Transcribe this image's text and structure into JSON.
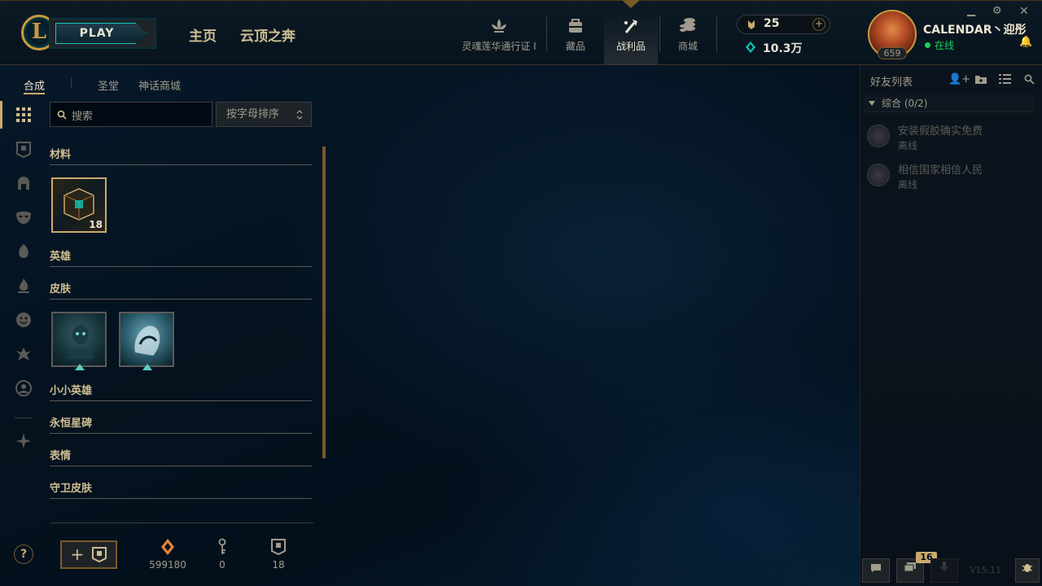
{
  "topbar": {
    "play_label": "PLAY",
    "logo_letter": "L",
    "nav_main": [
      {
        "label": "主页"
      },
      {
        "label": "云顶之奔"
      }
    ],
    "nav_icons": [
      {
        "label": "灵魂莲华通行证 I",
        "icon": "lotus-icon"
      },
      {
        "label": "藏品",
        "icon": "collection-bag-icon"
      },
      {
        "label": "战利品",
        "icon": "loot-crafting-icon",
        "active": true
      },
      {
        "label": "商城",
        "icon": "store-coins-icon"
      }
    ],
    "currency": {
      "rp": "25",
      "be": "10.3万"
    },
    "profile": {
      "name": "CALENDAR丶迎彤",
      "status": "在线",
      "level": "659"
    }
  },
  "loot": {
    "tabs": [
      {
        "label": "合成",
        "active": true
      },
      {
        "label": "圣堂"
      },
      {
        "label": "神话商城"
      }
    ],
    "search_placeholder": "搜索",
    "sort_label": "按字母排序",
    "categories": {
      "materials": "材料",
      "champions": "英雄",
      "skins": "皮肤",
      "little_legends": "小小英雄",
      "eternals": "永恒星碑",
      "emotes": "表情",
      "ward_skins": "守卫皮肤"
    },
    "material_count": "18",
    "counters": [
      {
        "icon": "orange-essence-icon",
        "value": "599180"
      },
      {
        "icon": "key-icon",
        "value": "0"
      },
      {
        "icon": "chest-icon",
        "value": "18"
      }
    ],
    "help_label": "?",
    "craft_label": "+"
  },
  "friends": {
    "title": "好友列表",
    "group": "综合 (0/2)",
    "list": [
      {
        "name": "安装假胶确实免费",
        "status": "离线"
      },
      {
        "name": "相信国家相信人民",
        "status": "离线"
      }
    ],
    "notif_count": "16",
    "version": "V15.11"
  },
  "colors": {
    "gold": "#c89b3c",
    "teal": "#0ac8b9",
    "text_gold": "#cdbe91",
    "online_green": "#0acbe6"
  }
}
